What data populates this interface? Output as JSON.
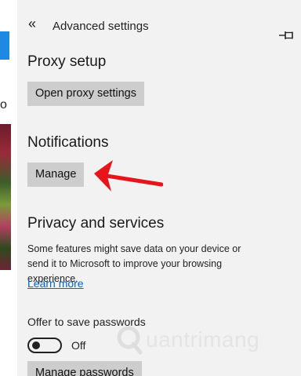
{
  "header": {
    "back_icon": "«",
    "title": "Advanced settings",
    "pin_icon": "pin-icon"
  },
  "background": {
    "partial_letter": "o"
  },
  "proxy": {
    "title": "Proxy setup",
    "button_label": "Open proxy settings"
  },
  "notifications": {
    "title": "Notifications",
    "button_label": "Manage"
  },
  "privacy": {
    "title": "Privacy and services",
    "description": "Some features might save data on your device or send it to Microsoft to improve your browsing experience.",
    "learn_more": "Learn more"
  },
  "passwords": {
    "label": "Offer to save passwords",
    "toggle_state": "Off",
    "manage_label": "Manage passwords"
  },
  "watermark": {
    "text": "uantrimang"
  },
  "colors": {
    "arrow": "#e8141b",
    "link": "#0066cc",
    "button_bg": "#cdcdcd",
    "panel_bg": "#f2f2f2"
  }
}
